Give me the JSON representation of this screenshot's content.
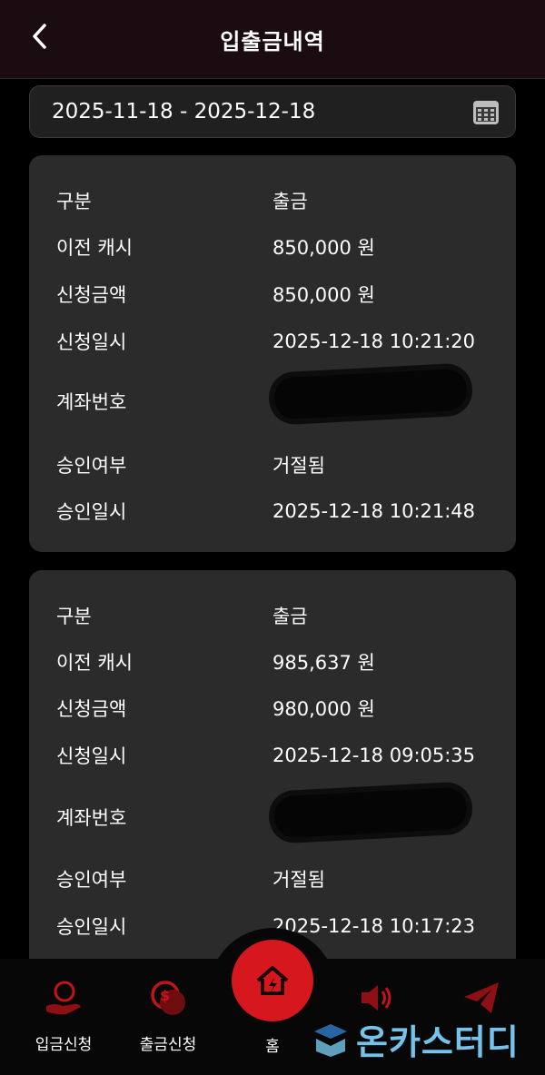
{
  "header": {
    "title": "입출금내역"
  },
  "date_range": "2025-11-18 - 2025-12-18",
  "transactions": [
    {
      "category_label": "구분",
      "category_value": "출금",
      "prev_cash_label": "이전 캐시",
      "prev_cash_value": "850,000 원",
      "amount_label": "신청금액",
      "amount_value": "850,000 원",
      "request_time_label": "신청일시",
      "request_time_value": "2025-12-18 10:21:20",
      "account_label": "계좌번호",
      "status_label": "승인여부",
      "status_value": "거절됨",
      "approval_time_label": "승인일시",
      "approval_time_value": "2025-12-18 10:21:48"
    },
    {
      "category_label": "구분",
      "category_value": "출금",
      "prev_cash_label": "이전 캐시",
      "prev_cash_value": "985,637 원",
      "amount_label": "신청금액",
      "amount_value": "980,000 원",
      "request_time_label": "신청일시",
      "request_time_value": "2025-12-18 09:05:35",
      "account_label": "계좌번호",
      "status_label": "승인여부",
      "status_value": "거절됨",
      "approval_time_label": "승인일시",
      "approval_time_value": "2025-12-18 10:17:23"
    }
  ],
  "nav": {
    "deposit": "입금신청",
    "withdraw": "출금신청",
    "home": "홈"
  },
  "watermark": "온카스터디",
  "colors": {
    "accent": "#d6181e",
    "card": "#2b2b2b",
    "header": "#1a0c10"
  },
  "icons": [
    "back-arrow-icon",
    "calendar-icon",
    "deposit-hand-coin-icon",
    "withdraw-coin-icon",
    "home-house-icon",
    "speaker-icon",
    "paper-plane-icon"
  ]
}
